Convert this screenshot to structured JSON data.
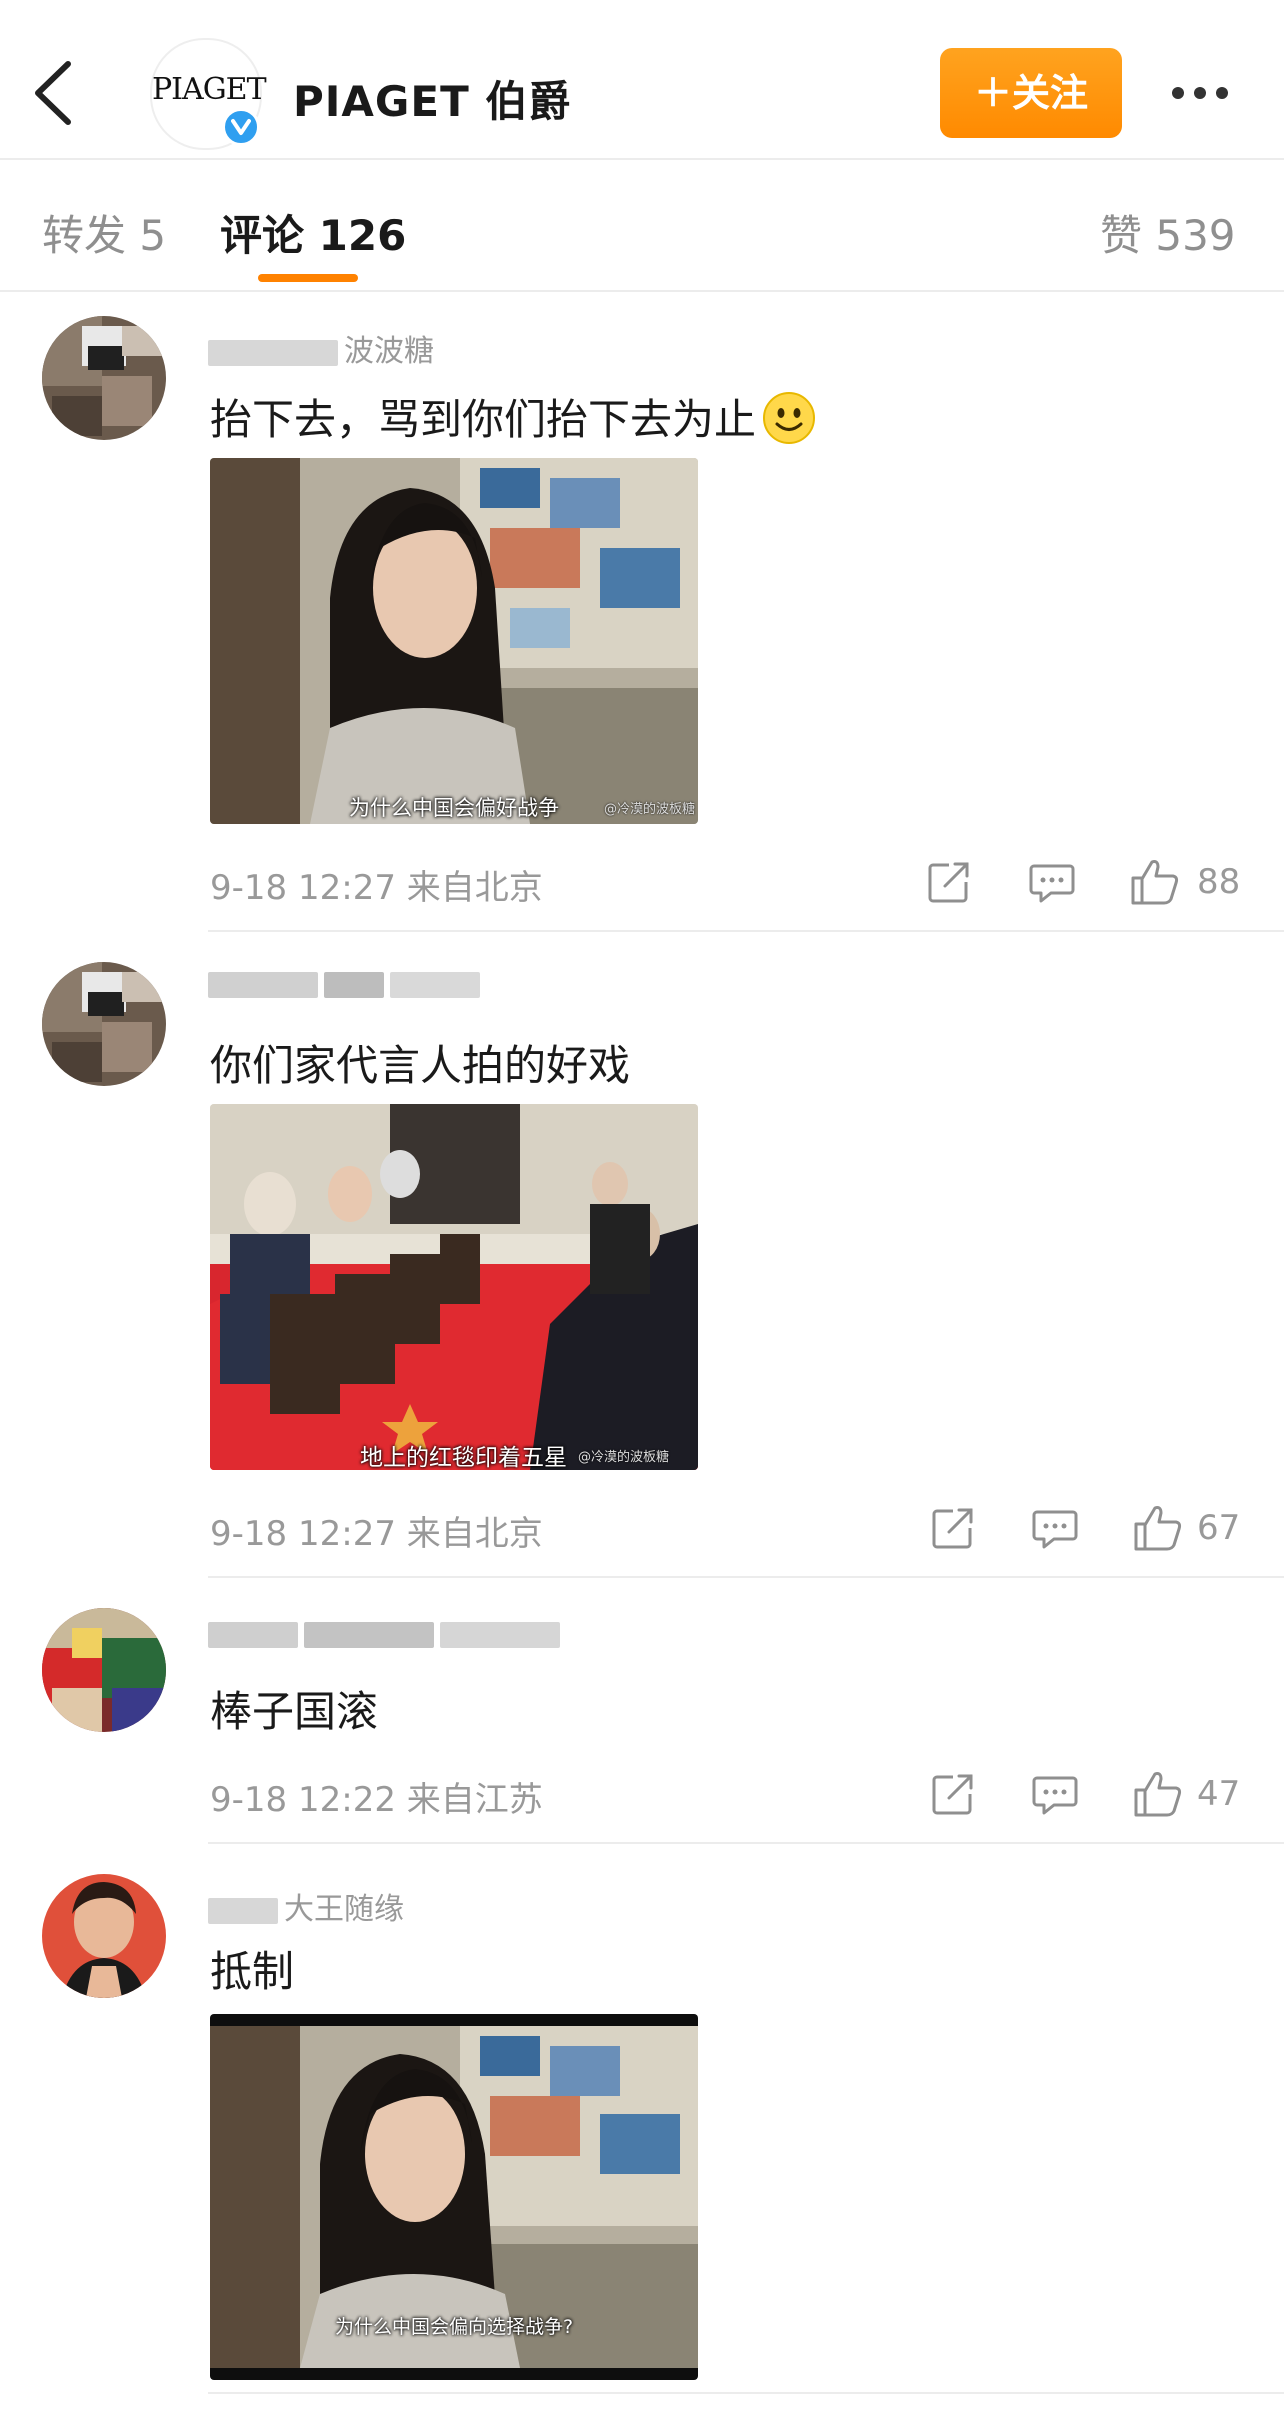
{
  "header": {
    "back_icon": "chevron-left-icon",
    "logo_text": "PIAGET",
    "verified_icon": "verified-badge-icon",
    "title": "PIAGET 伯爵",
    "follow_label": "＋关注",
    "more_icon": "more-horizontal-icon",
    "accent_color": "#ff8a00"
  },
  "tabs": {
    "repost": "转发 5",
    "comments": "评论 126",
    "likes": "赞 539"
  },
  "comments": [
    {
      "username_visible": "波波糖",
      "text": "抬下去，骂到你们抬下去为止",
      "emoji": "smiley-face-icon",
      "image_caption": "为什么中国会偏好战争",
      "image_watermark": "@冷漠的波板糖",
      "time": "9-18 12:27",
      "location": "来自北京",
      "like_count": "88"
    },
    {
      "text": "你们家代言人拍的好戏",
      "image_caption": "地上的红毯印着五星",
      "image_watermark": "@冷漠的波板糖",
      "time": "9-18 12:27",
      "location": "来自北京",
      "like_count": "67"
    },
    {
      "text": "棒子国滚",
      "time": "9-18 12:22",
      "location": "来自江苏",
      "like_count": "47"
    },
    {
      "username_visible": "大王随缘",
      "text": "抵制",
      "image_caption": "为什么中国会偏向选择战争?"
    }
  ]
}
